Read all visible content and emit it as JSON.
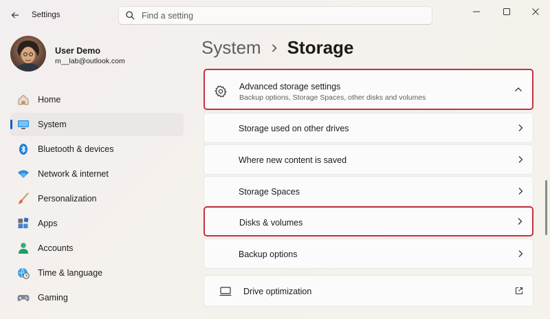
{
  "window": {
    "title": "Settings",
    "search_placeholder": "Find a setting"
  },
  "profile": {
    "name": "User Demo",
    "email": "m__lab@outlook.com"
  },
  "nav": [
    {
      "label": "Home",
      "icon": "home-icon"
    },
    {
      "label": "System",
      "icon": "system-icon",
      "active": true
    },
    {
      "label": "Bluetooth & devices",
      "icon": "bluetooth-icon"
    },
    {
      "label": "Network & internet",
      "icon": "wifi-icon"
    },
    {
      "label": "Personalization",
      "icon": "brush-icon"
    },
    {
      "label": "Apps",
      "icon": "apps-icon"
    },
    {
      "label": "Accounts",
      "icon": "person-icon"
    },
    {
      "label": "Time & language",
      "icon": "globe-clock-icon"
    },
    {
      "label": "Gaming",
      "icon": "gamepad-icon"
    }
  ],
  "breadcrumb": {
    "parent": "System",
    "current": "Storage"
  },
  "advanced": {
    "title": "Advanced storage settings",
    "subtitle": "Backup options, Storage Spaces, other disks and volumes",
    "items": [
      "Storage used on other drives",
      "Where new content is saved",
      "Storage Spaces",
      "Disks & volumes",
      "Backup options"
    ]
  },
  "drive_optimization": {
    "label": "Drive optimization"
  },
  "colors": {
    "accent": "#0a5ec4",
    "highlight": "#c4303e"
  }
}
